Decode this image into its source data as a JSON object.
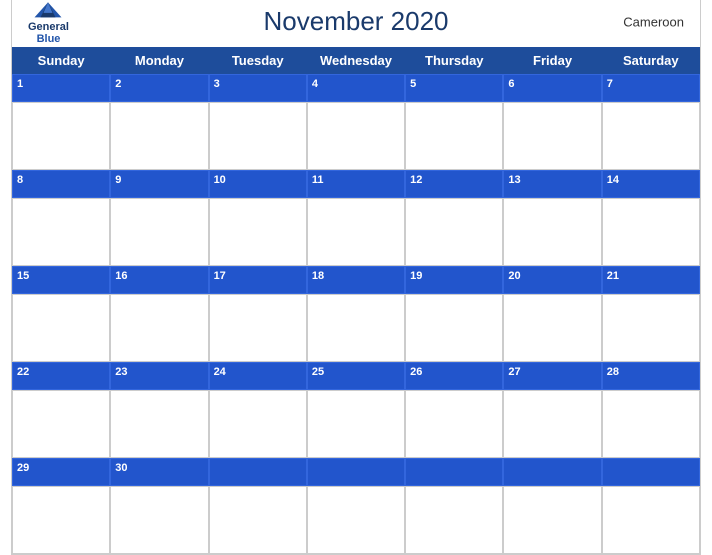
{
  "header": {
    "title": "November 2020",
    "country": "Cameroon",
    "logo": {
      "general": "General",
      "blue": "Blue"
    }
  },
  "days_of_week": [
    "Sunday",
    "Monday",
    "Tuesday",
    "Wednesday",
    "Thursday",
    "Friday",
    "Saturday"
  ],
  "weeks": [
    {
      "date_numbers": [
        1,
        2,
        3,
        4,
        5,
        6,
        7
      ]
    },
    {
      "date_numbers": [
        8,
        9,
        10,
        11,
        12,
        13,
        14
      ]
    },
    {
      "date_numbers": [
        15,
        16,
        17,
        18,
        19,
        20,
        21
      ]
    },
    {
      "date_numbers": [
        22,
        23,
        24,
        25,
        26,
        27,
        28
      ]
    },
    {
      "date_numbers": [
        29,
        30,
        null,
        null,
        null,
        null,
        null
      ]
    }
  ],
  "colors": {
    "header_bg": "#1e4d9b",
    "row_header_bg": "#2255bb",
    "cell_border": "#ccc",
    "title_color": "#1a3a6b",
    "day_number_color": "#fff"
  }
}
